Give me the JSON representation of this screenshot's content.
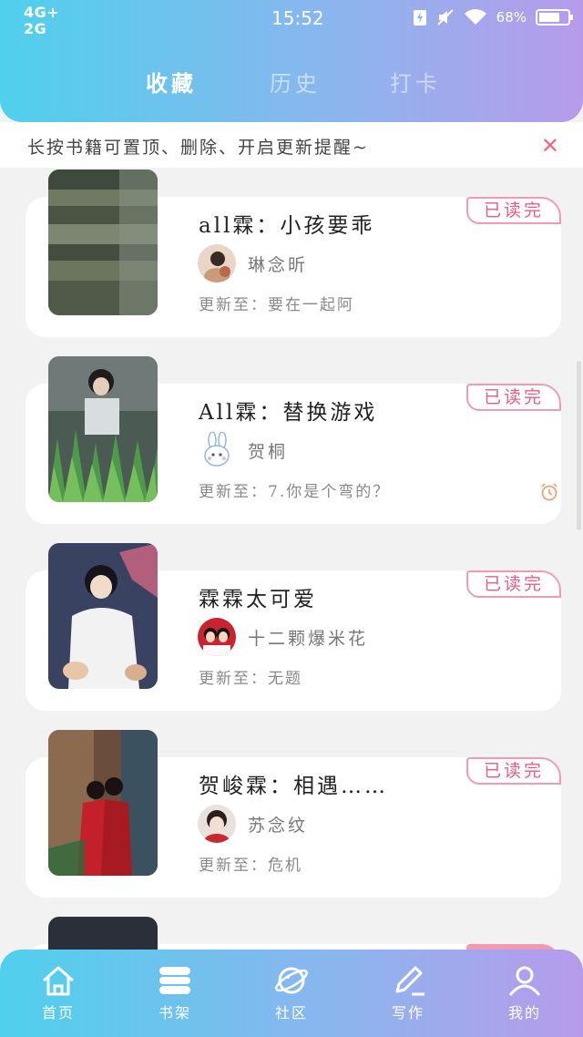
{
  "status_bar": {
    "network_top": "4G+",
    "network_bottom": "2G",
    "time": "15:52",
    "battery": "68%"
  },
  "tabs": [
    {
      "label": "收藏",
      "active": true
    },
    {
      "label": "历史",
      "active": false
    },
    {
      "label": "打卡",
      "active": false
    }
  ],
  "tip": {
    "text": "长按书籍可置顶、删除、开启更新提醒~",
    "close_icon": "close-icon"
  },
  "books": [
    {
      "title": "all霖：小孩要乖",
      "author": "琳念昕",
      "update": "更新至：要在一起阿",
      "badge": "已读完",
      "alarm": false
    },
    {
      "title": "All霖：替换游戏",
      "author": "贺桐",
      "update": "更新至：7.你是个弯的？",
      "badge": "已读完",
      "alarm": true
    },
    {
      "title": "霖霖太可爱",
      "author": "十二颗爆米花",
      "update": "更新至：无题",
      "badge": "已读完",
      "alarm": false
    },
    {
      "title": "贺峻霖：相遇……",
      "author": "苏念纹",
      "update": "更新至：危机",
      "badge": "已读完",
      "alarm": false
    }
  ],
  "bottom_nav": [
    {
      "label": "首页",
      "icon": "home-icon"
    },
    {
      "label": "书架",
      "icon": "bookshelf-icon"
    },
    {
      "label": "社区",
      "icon": "planet-icon"
    },
    {
      "label": "写作",
      "icon": "pen-icon"
    },
    {
      "label": "我的",
      "icon": "user-icon"
    }
  ],
  "colors": {
    "gradient_start": "#4fd0ec",
    "gradient_end": "#b79bea",
    "badge": "#ea5c84",
    "close": "#f26b7a"
  }
}
